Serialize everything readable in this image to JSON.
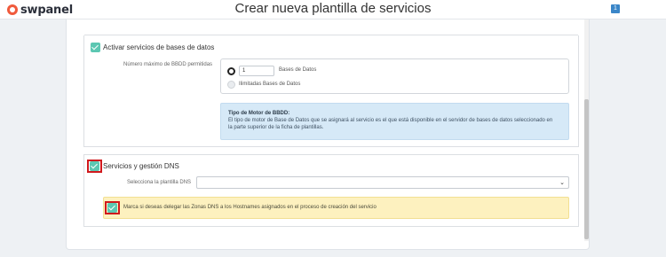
{
  "header": {
    "logo_text": "swpanel",
    "title": "Crear nueva plantilla de servicios",
    "notification_count": "1"
  },
  "database_section": {
    "checked": true,
    "title": "Activar servicios de bases de datos",
    "max_label": "Número máximo de BBDD permitidas",
    "count_value": "1",
    "count_unit": "Bases de Datos",
    "unlimited_label": "Ilimitadas Bases de Datos",
    "info_title": "Tipo de Motor de BBDD:",
    "info_line1": "El tipo de motor de Base de Datos que se asignará al servicio es el que está disponible en el servidor de bases de datos seleccionado en",
    "info_line2": "la parte superior de la ficha de plantillas."
  },
  "dns_section": {
    "checked": true,
    "title": "Servicios y gestión DNS",
    "template_label": "Selecciona la plantilla DNS",
    "template_value": "",
    "delegate_checked": true,
    "delegate_label": "Marca si deseas delegar las Zonas DNS a los Hostnames asignados en el proceso de creación del servicio"
  },
  "colors": {
    "accent_teal": "#5cc7b2",
    "highlight_red": "#d0191d",
    "info_blue": "#d6e9f7",
    "warning_yellow": "#fdf1bf",
    "brand_orange": "#f05a3c"
  }
}
